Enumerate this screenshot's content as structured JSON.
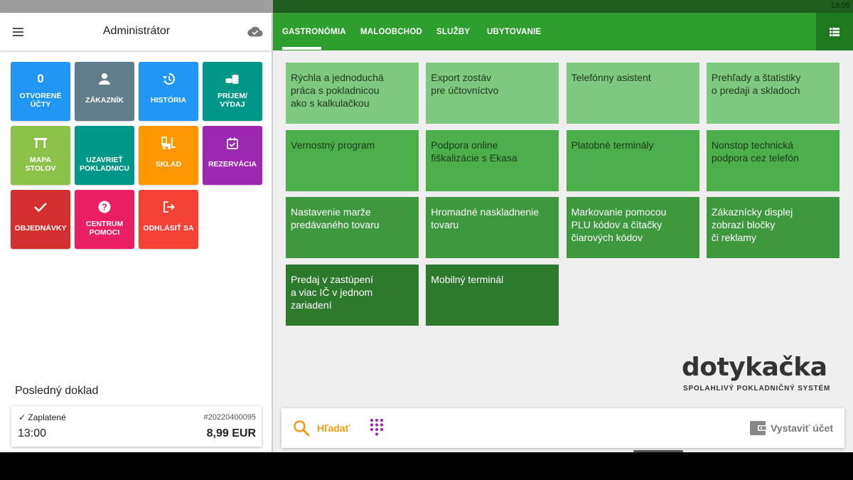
{
  "status_bar": {
    "time": "13:05"
  },
  "left_panel": {
    "title": "Administrátor",
    "tiles": [
      {
        "icon": "0",
        "label": "OTVORENÉ\nÚČTY",
        "color": "#2196f3"
      },
      {
        "icon": "person-icon",
        "label": "ZÁKAZNÍK",
        "color": "#607d8b"
      },
      {
        "icon": "history-icon",
        "label": "HISTÓRIA",
        "color": "#2196f3"
      },
      {
        "icon": "coins-icon",
        "label": "PRÍJEM/\nVÝDAJ",
        "color": "#009688"
      },
      {
        "icon": "table-icon",
        "label": "MAPA\nSTOLOV",
        "color": "#8bc34a"
      },
      {
        "icon": "register-icon",
        "label": "UZAVRIEŤ\nPOKLADNICU",
        "color": "#009688"
      },
      {
        "icon": "forklift-icon",
        "label": "SKLAD",
        "color": "#ff9800"
      },
      {
        "icon": "calendar-icon",
        "label": "REZERVÁCIA",
        "color": "#9c27b0"
      },
      {
        "icon": "check-icon",
        "label": "OBJEDNÁVKY",
        "color": "#d32f2f"
      },
      {
        "icon": "help-icon",
        "label": "CENTRUM\nPOMOCI",
        "color": "#e91e63"
      },
      {
        "icon": "logout-icon",
        "label": "ODHLÁSIŤ SA",
        "color": "#f44336"
      }
    ],
    "last_doc": {
      "title": "Posledný doklad",
      "status": "Zaplatené",
      "number": "#20220400095",
      "time": "13:00",
      "amount": "8,99 EUR"
    }
  },
  "tabs": [
    {
      "label": "GASTRONÓMIA",
      "active": true
    },
    {
      "label": "MALOOBCHOD",
      "active": false
    },
    {
      "label": "SLUŽBY",
      "active": false
    },
    {
      "label": "UBYTOVANIE",
      "active": false
    }
  ],
  "cards": [
    [
      "Rýchla a jednoduchá\npráca s pokladnicou\nako s kalkulačkou",
      "Export zostáv\npre účtovníctvo",
      "Telefónny asistent",
      "Prehľady a štatistiky\no predaji a skladoch"
    ],
    [
      "Vernostný program",
      "Podpora online\nfiškalizácie s Ekasa",
      "Platobné terminály",
      "Nonstop technická\npodpora cez telefón"
    ],
    [
      "Nastavenie marže\npredávaného tovaru",
      "Hromadné naskladnenie\ntovaru",
      "Markovanie pomocou\nPLU kódov a čítačky\nčiarových kódov",
      "Zákaznícky displej\nzobrazí bločky\nči reklamy"
    ],
    [
      "Predaj v zastúpení\na viac IČ v jednom\nzariadení",
      "Mobilný terminál"
    ]
  ],
  "logo": {
    "word": "dotykačka",
    "tagline": "SPOLAHLIVÝ POKLADNIČNÝ SYSTÉM"
  },
  "bottom_bar": {
    "search_label": "Hľadať",
    "bill_label": "Vystaviť účet"
  },
  "colors": {
    "green": "#2e9e2e",
    "dark_green": "#1f7a1f",
    "search_orange": "#f39c12",
    "keypad_purple": "#9c27b0"
  }
}
